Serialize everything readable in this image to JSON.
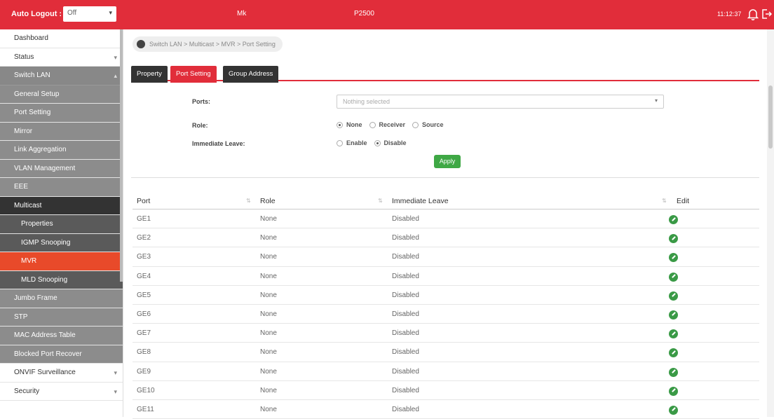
{
  "topbar": {
    "logout_label": "Auto Logout :",
    "logout_value": "Off",
    "model": "Mk",
    "product": "P2500",
    "time": "11:12:37"
  },
  "sidebar": {
    "items": [
      {
        "label": "Dashboard"
      },
      {
        "label": "Status"
      },
      {
        "label": "Switch LAN"
      },
      {
        "label": "General Setup"
      },
      {
        "label": "Port Setting"
      },
      {
        "label": "Mirror"
      },
      {
        "label": "Link Aggregation"
      },
      {
        "label": "VLAN Management"
      },
      {
        "label": "EEE"
      },
      {
        "label": "Multicast"
      },
      {
        "label": "Properties"
      },
      {
        "label": "IGMP Snooping"
      },
      {
        "label": "MVR"
      },
      {
        "label": "MLD Snooping"
      },
      {
        "label": "Jumbo Frame"
      },
      {
        "label": "STP"
      },
      {
        "label": "MAC Address Table"
      },
      {
        "label": "Blocked Port Recover"
      },
      {
        "label": "ONVIF Surveillance"
      },
      {
        "label": "Security"
      }
    ]
  },
  "breadcrumb": "Switch LAN > Multicast > MVR > Port Setting",
  "tabs": [
    {
      "label": "Property"
    },
    {
      "label": "Port Setting"
    },
    {
      "label": "Group Address"
    }
  ],
  "form": {
    "ports_label": "Ports:",
    "ports_placeholder": "Nothing selected",
    "role_label": "Role:",
    "role_options": [
      "None",
      "Receiver",
      "Source"
    ],
    "role_selected": "None",
    "leave_label": "Immediate Leave:",
    "leave_options": [
      "Enable",
      "Disable"
    ],
    "leave_selected": "Disable",
    "apply_label": "Apply"
  },
  "table": {
    "headers": [
      "Port",
      "Role",
      "Immediate Leave",
      "Edit"
    ],
    "rows": [
      {
        "port": "GE1",
        "role": "None",
        "leave": "Disabled"
      },
      {
        "port": "GE2",
        "role": "None",
        "leave": "Disabled"
      },
      {
        "port": "GE3",
        "role": "None",
        "leave": "Disabled"
      },
      {
        "port": "GE4",
        "role": "None",
        "leave": "Disabled"
      },
      {
        "port": "GE5",
        "role": "None",
        "leave": "Disabled"
      },
      {
        "port": "GE6",
        "role": "None",
        "leave": "Disabled"
      },
      {
        "port": "GE7",
        "role": "None",
        "leave": "Disabled"
      },
      {
        "port": "GE8",
        "role": "None",
        "leave": "Disabled"
      },
      {
        "port": "GE9",
        "role": "None",
        "leave": "Disabled"
      },
      {
        "port": "GE10",
        "role": "None",
        "leave": "Disabled"
      },
      {
        "port": "GE11",
        "role": "None",
        "leave": "Disabled"
      }
    ]
  },
  "colors": {
    "brand": "#e12d3a",
    "active_menu": "#e84a2a",
    "apply": "#3fa845",
    "edit": "#3a9a46"
  },
  "icons": {
    "bell": "bell-icon",
    "logout": "logout-icon",
    "edit": "edit-check-icon",
    "home": "home-icon"
  }
}
